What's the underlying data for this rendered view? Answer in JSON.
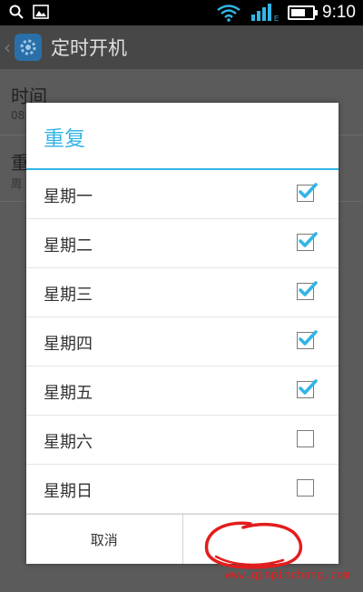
{
  "status_bar": {
    "time": "9:10",
    "network_type": "E",
    "battery_level": 0.7,
    "icons": [
      "search-icon",
      "image-icon",
      "wifi-icon",
      "signal-icon",
      "battery-icon"
    ]
  },
  "app_bar": {
    "title": "定时开机",
    "icon": "gear-icon"
  },
  "background_items": [
    {
      "title": "时间",
      "subtitle": "08"
    },
    {
      "title": "重",
      "subtitle": "周"
    }
  ],
  "dialog": {
    "title": "重复",
    "options": [
      {
        "label": "星期一",
        "checked": true
      },
      {
        "label": "星期二",
        "checked": true
      },
      {
        "label": "星期三",
        "checked": true
      },
      {
        "label": "星期四",
        "checked": true
      },
      {
        "label": "星期五",
        "checked": true
      },
      {
        "label": "星期六",
        "checked": false
      },
      {
        "label": "星期日",
        "checked": false
      }
    ],
    "cancel_label": "取消",
    "ok_label": ""
  },
  "colors": {
    "accent": "#33b5e5",
    "scribble": "#e21d1d"
  },
  "watermark": "www.qinpinchang.com"
}
